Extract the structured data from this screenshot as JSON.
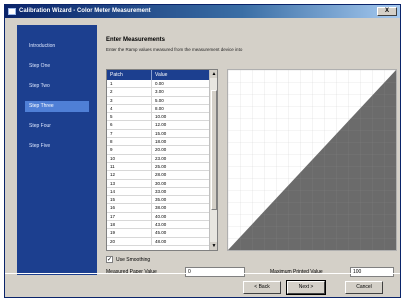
{
  "window": {
    "title": "Calibration Wizard - Color Meter Measurement",
    "close_label": "X"
  },
  "sidebar": {
    "items": [
      {
        "label": "Introduction"
      },
      {
        "label": "Step One"
      },
      {
        "label": "Step Two"
      },
      {
        "label": "Step Three",
        "active": true
      },
      {
        "label": "Step Four"
      },
      {
        "label": "Step Five"
      }
    ]
  },
  "main": {
    "heading": "Enter Measurements",
    "instructions": "Enter the Ramp values measured from the measurement device into",
    "table": {
      "columns": [
        "Patch",
        "Value"
      ],
      "rows": [
        [
          "1",
          "0.00"
        ],
        [
          "2",
          "3.00"
        ],
        [
          "3",
          "5.00"
        ],
        [
          "4",
          "8.00"
        ],
        [
          "5",
          "10.00"
        ],
        [
          "6",
          "12.00"
        ],
        [
          "7",
          "15.00"
        ],
        [
          "8",
          "18.00"
        ],
        [
          "9",
          "20.00"
        ],
        [
          "10",
          "23.00"
        ],
        [
          "11",
          "25.00"
        ],
        [
          "12",
          "28.00"
        ],
        [
          "13",
          "30.00"
        ],
        [
          "14",
          "33.00"
        ],
        [
          "15",
          "35.00"
        ],
        [
          "16",
          "38.00"
        ],
        [
          "17",
          "40.00"
        ],
        [
          "18",
          "43.00"
        ],
        [
          "19",
          "45.00"
        ],
        [
          "20",
          "48.00"
        ]
      ]
    },
    "use_smoothing": {
      "label": "Use Smoothing",
      "checked": true
    },
    "min_label": "Measured Paper Value",
    "min_value": "0",
    "max_label": "Maximum Printed Value",
    "max_value": "100"
  },
  "buttons": {
    "back": "< Back",
    "next": "Next >",
    "cancel": "Cancel"
  }
}
